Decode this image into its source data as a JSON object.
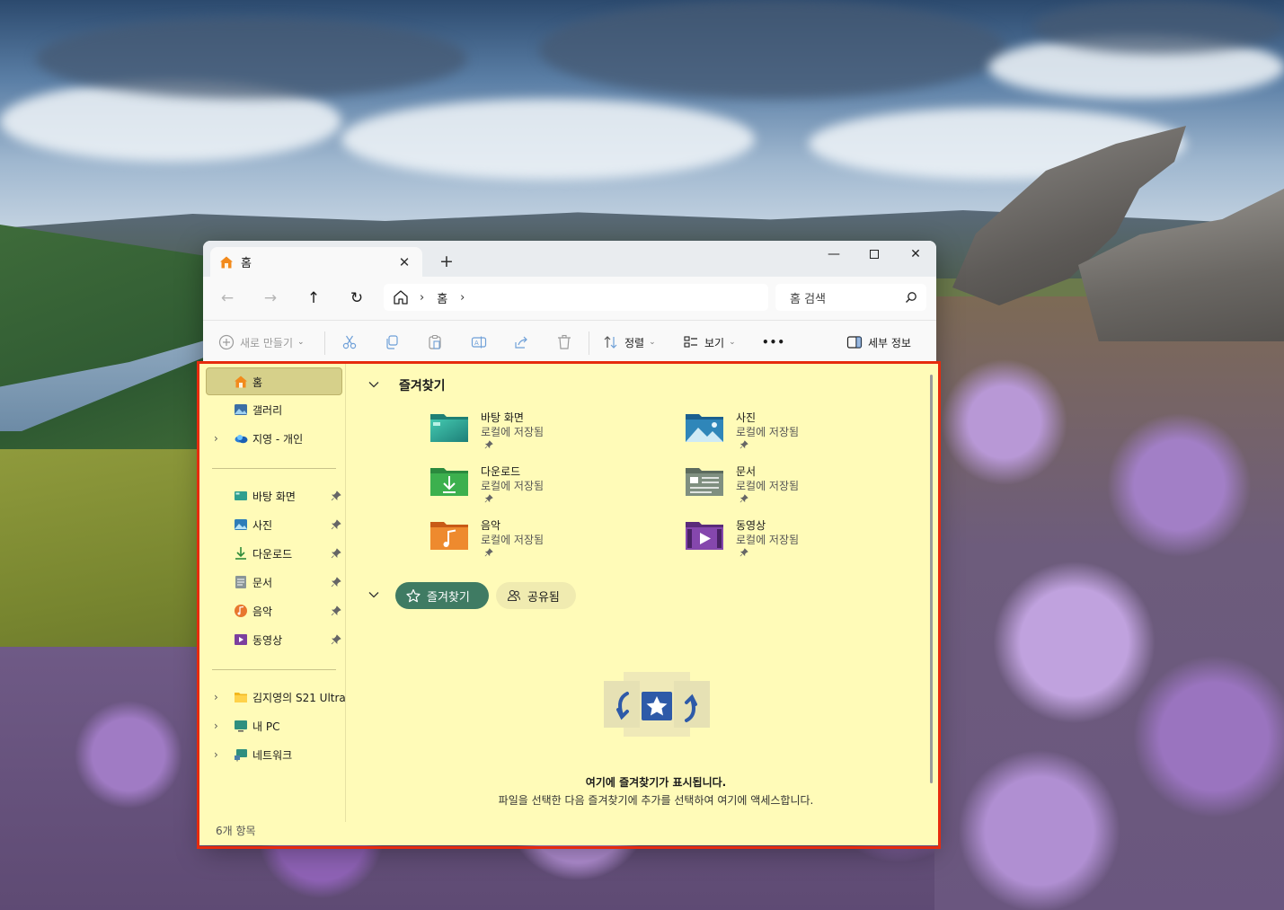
{
  "window": {
    "tab_title": "홈",
    "new_tab": "+",
    "close_tab": "✕",
    "minimize": "—",
    "close": "✕"
  },
  "nav": {
    "back": "←",
    "forward": "→",
    "up": "↑",
    "refresh": "↻",
    "breadcrumb_sep": "›",
    "breadcrumb_home": "홈",
    "search_placeholder": "홈 검색"
  },
  "toolbar": {
    "new_label": "새로 만들기",
    "sort_label": "정렬",
    "view_label": "보기",
    "more_label": "•••",
    "details_label": "세부 정보"
  },
  "sidebar": {
    "items": [
      {
        "label": "홈",
        "icon": "home-icon"
      },
      {
        "label": "갤러리",
        "icon": "gallery-icon"
      },
      {
        "label": "지영 - 개인",
        "icon": "onedrive-icon"
      },
      {
        "label": "바탕 화면",
        "icon": "desktop-icon"
      },
      {
        "label": "사진",
        "icon": "pictures-icon"
      },
      {
        "label": "다운로드",
        "icon": "downloads-icon"
      },
      {
        "label": "문서",
        "icon": "documents-icon"
      },
      {
        "label": "음악",
        "icon": "music-icon"
      },
      {
        "label": "동영상",
        "icon": "videos-icon"
      },
      {
        "label": "김지영의 S21 Ultra",
        "icon": "folder-icon"
      },
      {
        "label": "내 PC",
        "icon": "pc-icon"
      },
      {
        "label": "네트워크",
        "icon": "network-icon"
      }
    ],
    "status": "6개 항목"
  },
  "main": {
    "quick_access_title": "즐겨찾기",
    "tiles": [
      {
        "name": "바탕 화면",
        "sub": "로컬에 저장됨",
        "icon": "desktop-folder-icon"
      },
      {
        "name": "사진",
        "sub": "로컬에 저장됨",
        "icon": "pictures-folder-icon"
      },
      {
        "name": "다운로드",
        "sub": "로컬에 저장됨",
        "icon": "downloads-folder-icon"
      },
      {
        "name": "문서",
        "sub": "로컬에 저장됨",
        "icon": "documents-folder-icon"
      },
      {
        "name": "음악",
        "sub": "로컬에 저장됨",
        "icon": "music-folder-icon"
      },
      {
        "name": "동영상",
        "sub": "로컬에 저장됨",
        "icon": "videos-folder-icon"
      }
    ],
    "chip_favorites": "즐겨찾기",
    "chip_shared": "공유됨",
    "empty_title": "여기에 즐겨찾기가 표시됩니다.",
    "empty_desc": "파일을 선택한 다음 즐겨찾기에 추가를 선택하여 여기에 액세스합니다."
  },
  "colors": {
    "highlight_border": "#e62b0e",
    "content_bg": "#fffbb8",
    "chip_active": "#3f7b63"
  }
}
